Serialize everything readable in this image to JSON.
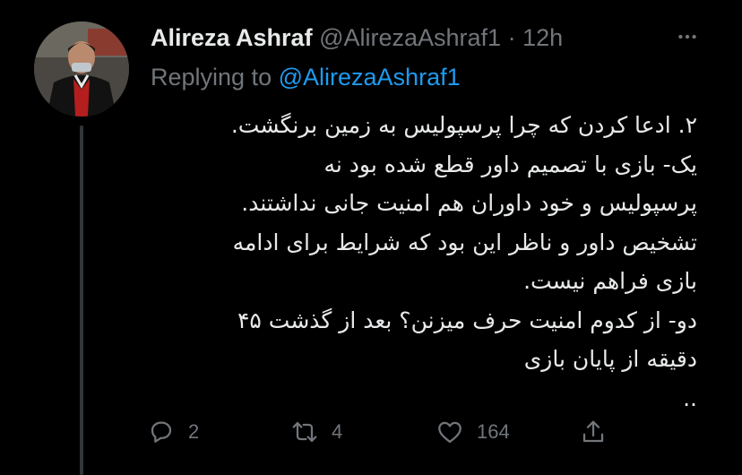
{
  "tweet": {
    "author_name": "Alireza Ashraf",
    "handle": "@AlirezaAshraf1",
    "separator": "·",
    "time": "12h",
    "replying_prefix": "Replying to",
    "replying_to": "@AlirezaAshraf1",
    "body_lines": [
      "۲. ادعا کردن که چرا پرسپولیس به زمین برنگشت.",
      "یک- بازی با تصمیم داور قطع شده بود نه",
      "پرسپولیس و خود داوران هم امنیت جانی نداشتند.",
      "تشخیص داور و ناظر این بود که شرایط برای ادامه",
      "بازی فراهم نیست.",
      "دو- از کدوم امنیت حرف میزنن؟ بعد از گذشت ۴۵",
      "دقیقه از پایان بازی",
      ".."
    ]
  },
  "actions": {
    "reply_count": "2",
    "retweet_count": "4",
    "like_count": "164"
  },
  "icons": {
    "more": "more-dots-icon",
    "reply": "reply-bubble-icon",
    "retweet": "retweet-arrows-icon",
    "like": "heart-icon",
    "share": "share-upload-icon"
  },
  "colors": {
    "background": "#000000",
    "text": "#e7e9ea",
    "muted": "#71767b",
    "accent": "#1d9bf0"
  }
}
